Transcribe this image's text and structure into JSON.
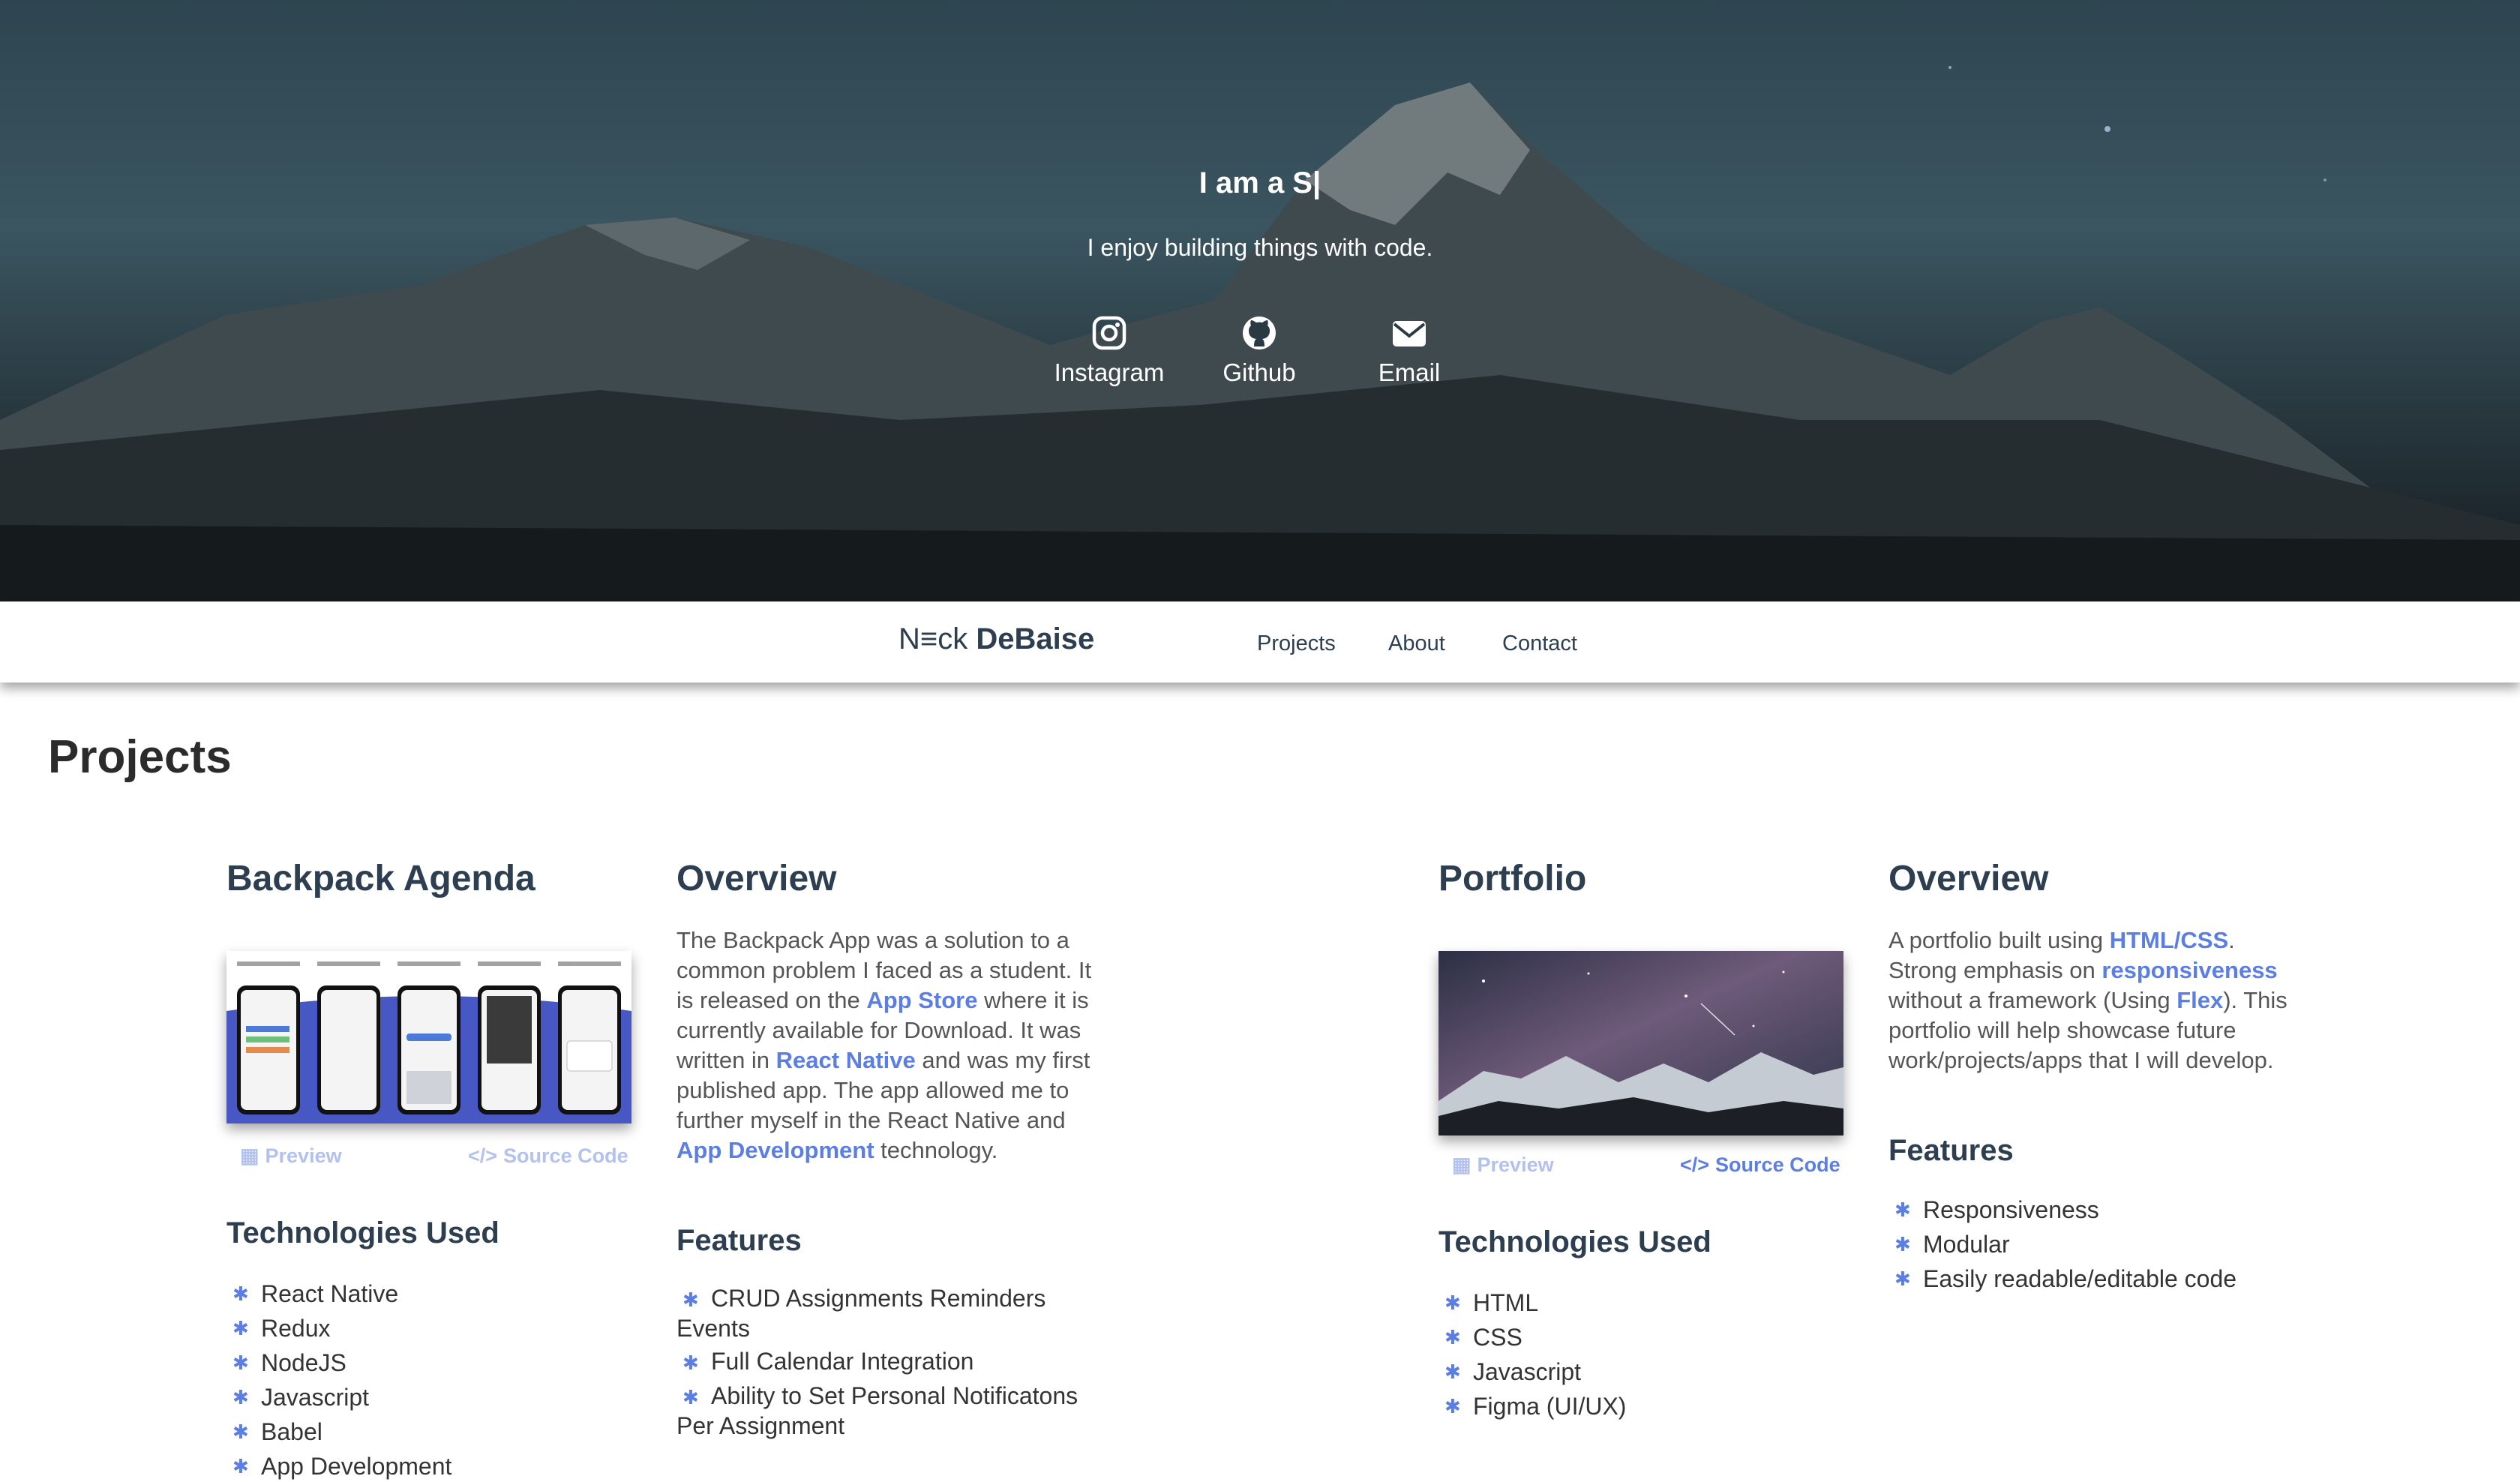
{
  "hero": {
    "title": "I am a S|",
    "subtitle": "I enjoy building things with code.",
    "links": [
      {
        "label": "Instagram",
        "icon": "instagram-icon"
      },
      {
        "label": "Github",
        "icon": "github-icon"
      },
      {
        "label": "Email",
        "icon": "email-icon"
      }
    ]
  },
  "nav": {
    "brand_first": "N≡ck",
    "brand_last": "DeBaise",
    "links": [
      "Projects",
      "About",
      "Contact"
    ]
  },
  "projects": {
    "heading": "Projects",
    "items": [
      {
        "title": "Backpack Agenda",
        "preview_label": "Preview",
        "source_label": "Source Code",
        "tech_heading": "Technologies Used",
        "tech": [
          "React Native",
          "Redux",
          "NodeJS",
          "Javascript",
          "Babel",
          "App Development"
        ],
        "overview_heading": "Overview",
        "overview_parts": {
          "p1": "The Backpack App was a solution to a common problem I faced as a student. It is released on the ",
          "h1": "App Store",
          "p2": " where it is currently available for Download. It was written in ",
          "h2": "React Native",
          "p3": " and was my first published app. The app allowed me to further myself in the React Native and ",
          "h3": "App Development",
          "p4": " technology."
        },
        "features_heading": "Features",
        "features": [
          "CRUD Assignments Reminders Events",
          "Full Calendar Integration",
          "Ability to Set Personal Notificatons Per Assignment"
        ]
      },
      {
        "title": "Portfolio",
        "preview_label": "Preview",
        "source_label": "Source Code",
        "tech_heading": "Technologies Used",
        "tech": [
          "HTML",
          "CSS",
          "Javascript",
          "Figma (UI/UX)"
        ],
        "overview_heading": "Overview",
        "overview_parts": {
          "p1": "A portfolio built using ",
          "h1": "HTML/CSS",
          "p2": ". Strong emphasis on ",
          "h2": "responsiveness",
          "p3": " without a framework (Using ",
          "h3": "Flex",
          "p4": "). This portfolio will help showcase future work/projects/apps that I will develop."
        },
        "features_heading": "Features",
        "features": [
          "Responsiveness",
          "Modular",
          "Easily readable/editable code"
        ]
      }
    ]
  },
  "colors": {
    "accent": "#5b7ee5",
    "heading": "#2c3e50",
    "hero_sky": "#3a5560"
  }
}
